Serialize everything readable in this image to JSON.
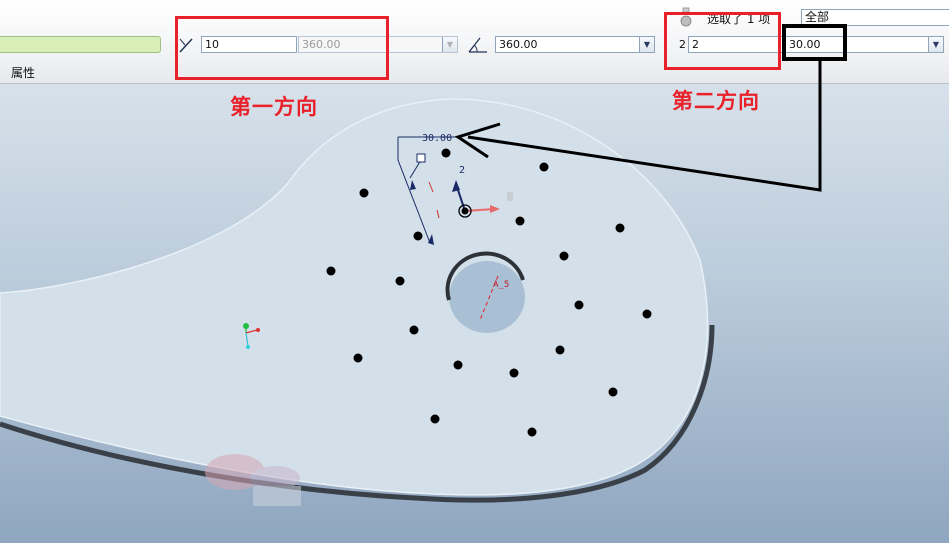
{
  "toolbar": {
    "property_label": "属性",
    "dir1_count": "10",
    "dir1_angle_placeholder": "360.00",
    "dir1_total_angle": "360.00",
    "dir2_prefix": "2",
    "dir2_count": "2",
    "dir2_angle": "30.00",
    "selection_text": "选取了 1 项",
    "filter_value": "全部"
  },
  "annotations": {
    "direction1": "第一方向",
    "direction2": "第二方向"
  },
  "model": {
    "dimension_angle": "30.00",
    "dimension_count": "2",
    "axis_label": "A_5"
  },
  "colors": {
    "highlight_red": "#e8212b",
    "part_fill": "#d3e0ea",
    "accent_green": "#d8f0b8"
  }
}
